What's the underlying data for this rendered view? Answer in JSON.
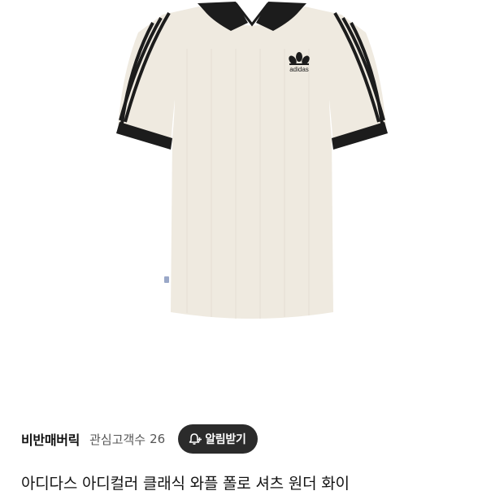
{
  "seller": {
    "name": "비반매버릭",
    "follower_label": "관심고객수",
    "follower_count": "26"
  },
  "notify_button": {
    "label": "알림받기",
    "icon": "bell-plus-icon"
  },
  "product": {
    "title": "아디다스 아디컬러 클래식 와플 폴로 셔츠 원더 화이",
    "image_alt": "adidas",
    "colors": {
      "body": "#efeae0",
      "trim": "#1c1c1c"
    }
  }
}
